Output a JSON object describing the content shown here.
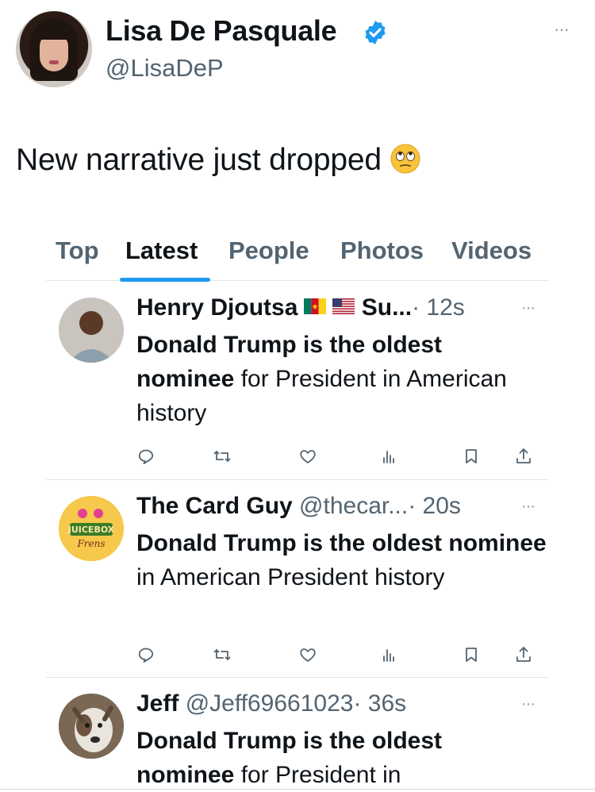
{
  "tweet": {
    "author_name": "Lisa De Pasquale",
    "author_handle": "@LisaDeP",
    "more_label": "···",
    "text": "New narrative just dropped",
    "emoji": "eye-roll-emoji",
    "verified_color": "#1d9bf0"
  },
  "embedded": {
    "tabs": [
      {
        "label": "Top",
        "active": false
      },
      {
        "label": "Latest",
        "active": true
      },
      {
        "label": "People",
        "active": false
      },
      {
        "label": "Photos",
        "active": false
      },
      {
        "label": "Videos",
        "active": false
      }
    ],
    "accent": "#1d9bf0",
    "posts": [
      {
        "name": "Henry Djoutsa",
        "flags": [
          "cameroon-flag",
          "usa-flag"
        ],
        "name_suffix": "Su...",
        "handle": "",
        "time": "· 12s",
        "more": "···",
        "body_bold": "Donald Trump is the oldest nominee",
        "body_rest": " for President in American history"
      },
      {
        "name": "The Card Guy",
        "handle": "@thecar...",
        "time": "· 20s",
        "more": "···",
        "body_bold": "Donald Trump is the oldest nominee",
        "body_rest": " in American President history",
        "avatar_text": "JUICEBOX Frens"
      },
      {
        "name": "Jeff",
        "handle": "@Jeff69661023",
        "time": "· 36s",
        "more": "···",
        "body_bold": "Donald Trump is the oldest nominee",
        "body_rest": " for President in"
      }
    ],
    "action_icons": [
      "reply-icon",
      "retweet-icon",
      "like-icon",
      "views-icon",
      "bookmark-icon",
      "share-icon"
    ]
  }
}
